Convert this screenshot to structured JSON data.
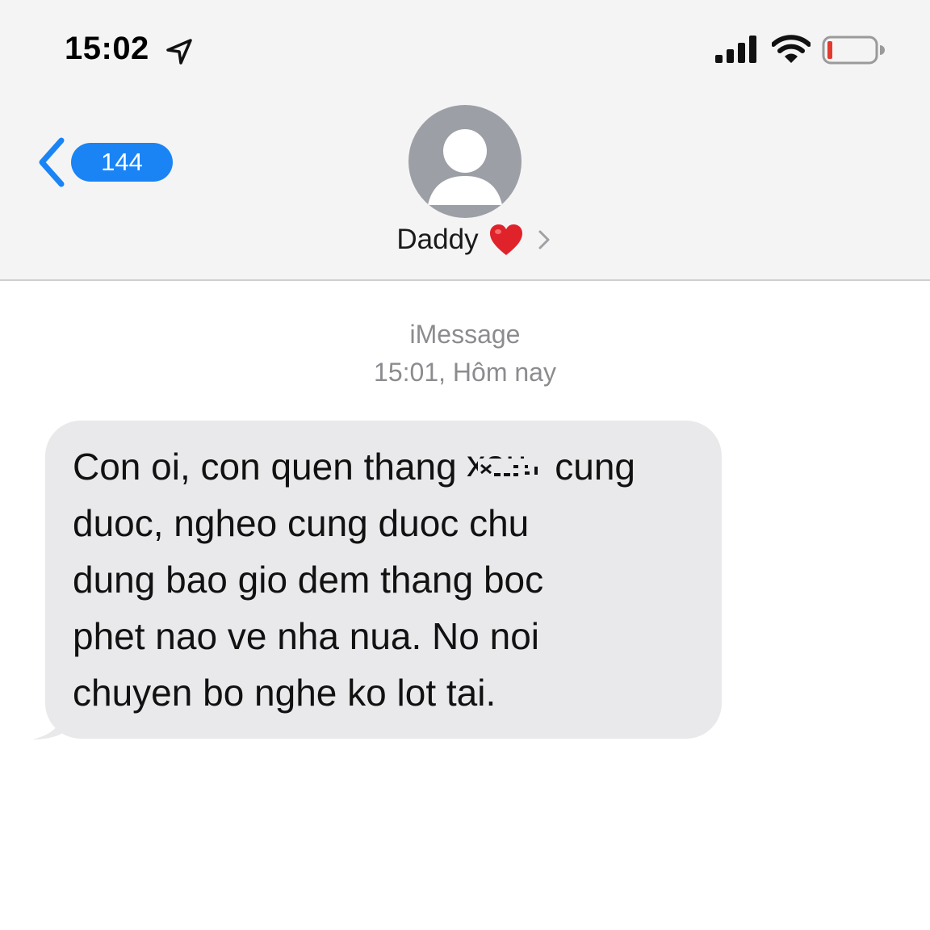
{
  "status_bar": {
    "time": "15:02",
    "icons": [
      "location-arrow-icon",
      "cellular-signal-icon",
      "wifi-icon",
      "battery-low-icon"
    ],
    "battery_color": "#e23b2e"
  },
  "nav": {
    "back_count": "144",
    "accent_color": "#1a84f5",
    "contact_name": "Daddy",
    "contact_emoji": "heart-icon",
    "heart_color": "#e0232b"
  },
  "conversation": {
    "service_label": "iMessage",
    "timestamp": "15:01, Hôm nay",
    "messages": [
      {
        "direction": "incoming",
        "lines": [
          {
            "before": "Con oi, con quen thang ",
            "redacted": true,
            "after": " cung"
          },
          {
            "text": "duoc, ngheo cung duoc chu"
          },
          {
            "text": "dung bao gio dem thang boc"
          },
          {
            "text": "phet nao ve nha nua. No noi"
          },
          {
            "text": "chuyen bo nghe ko lot tai."
          }
        ]
      }
    ]
  }
}
